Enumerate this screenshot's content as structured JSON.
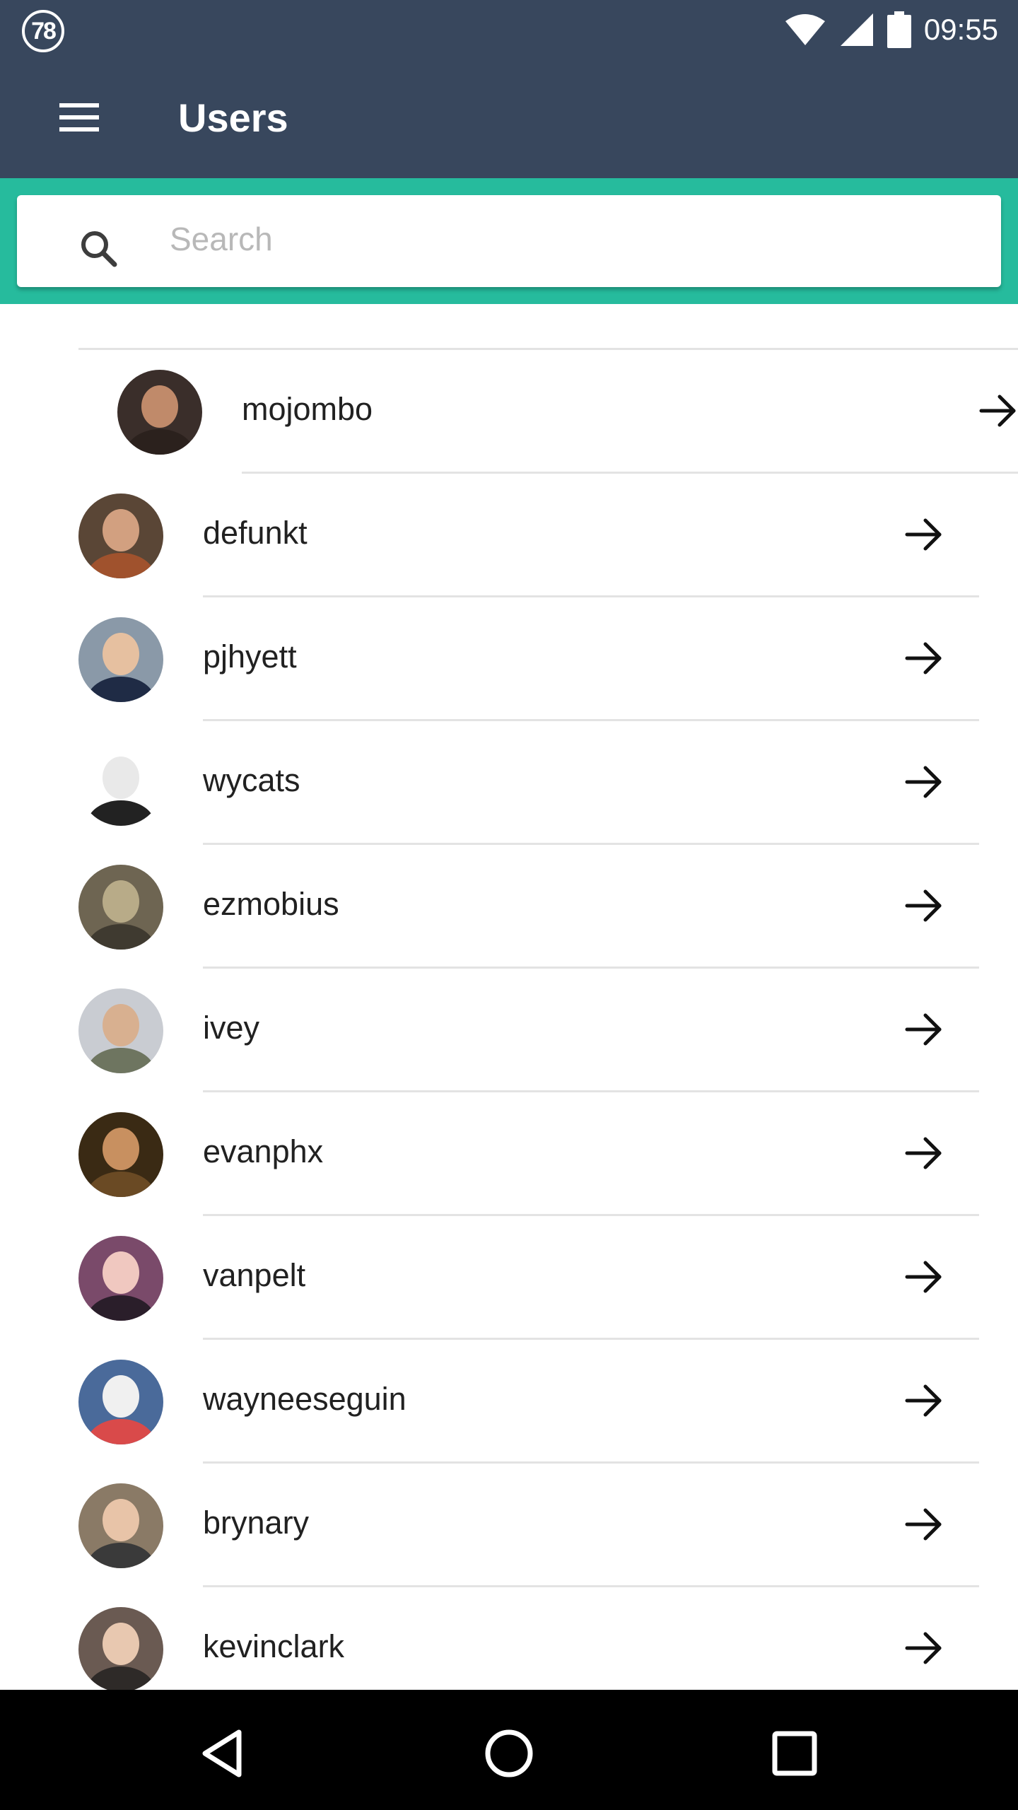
{
  "status_bar": {
    "notification_count": "78",
    "time": "09:55",
    "icons": [
      "wifi-icon",
      "signal-icon",
      "battery-icon"
    ]
  },
  "app_bar": {
    "title": "Users",
    "menu_icon": "hamburger-menu-icon"
  },
  "search": {
    "placeholder": "Search",
    "value": "",
    "icon": "search-icon"
  },
  "users": [
    {
      "login": "mojombo"
    },
    {
      "login": "defunkt"
    },
    {
      "login": "pjhyett"
    },
    {
      "login": "wycats"
    },
    {
      "login": "ezmobius"
    },
    {
      "login": "ivey"
    },
    {
      "login": "evanphx"
    },
    {
      "login": "vanpelt"
    },
    {
      "login": "wayneeseguin"
    },
    {
      "login": "brynary"
    },
    {
      "login": "kevinclark"
    }
  ],
  "nav_bar": {
    "back_icon": "back-triangle-icon",
    "home_icon": "home-circle-icon",
    "recents_icon": "recents-square-icon"
  },
  "colors": {
    "app_bar": "#38475d",
    "search_band": "#26bb9d",
    "divider": "#e3e3e3",
    "nav_bar": "#000000"
  }
}
